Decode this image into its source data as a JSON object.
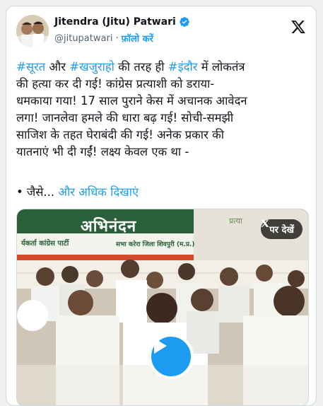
{
  "tweet": {
    "author_name": "Jitendra (Jitu) Patwari",
    "handle": "@jitupatwari",
    "separator": "·",
    "follow_label": "फ़ॉलो करें",
    "lines": [
      [
        {
          "t": "#सूरत",
          "tag": true
        },
        {
          "t": " और ",
          "tag": false
        },
        {
          "t": "#खजुराहो",
          "tag": true
        },
        {
          "t": " की तरह ही ",
          "tag": false
        },
        {
          "t": "#इंदौर",
          "tag": true
        },
        {
          "t": " में लोकतंत्र",
          "tag": false
        }
      ],
      [
        {
          "t": "की हत्या कर दी गई! कांग्रेस प्रत्याशी को डराया-",
          "tag": false
        }
      ],
      [
        {
          "t": "धमकाया गया! 17 साल पुराने केस में अचानक आवेदन",
          "tag": false
        }
      ],
      [
        {
          "t": "लगा! जानलेवा हमले की धारा बढ़ गई! सोची-समझी",
          "tag": false
        }
      ],
      [
        {
          "t": "साजिश के तहत घेराबंदी की गई! अनेक प्रकार की",
          "tag": false
        }
      ],
      [
        {
          "t": "यातनाएं भी दी गईं! लक्ष्य केवल एक था -",
          "tag": false
        }
      ]
    ],
    "bullet_text": "• जैसे...",
    "show_more": "और अधिक दिखाएं"
  },
  "media": {
    "watch_label": "पर देखें",
    "banner_text": "अभिनंदन",
    "banner_small": "र्यकर्ता कांग्रेस पार्टी",
    "banner_small_2": "सभा करेरा जिला शिवपुरी (म.प्र.)"
  },
  "colors": {
    "accent": "#1d9bf0",
    "text": "#0f1419",
    "muted": "#536471"
  }
}
